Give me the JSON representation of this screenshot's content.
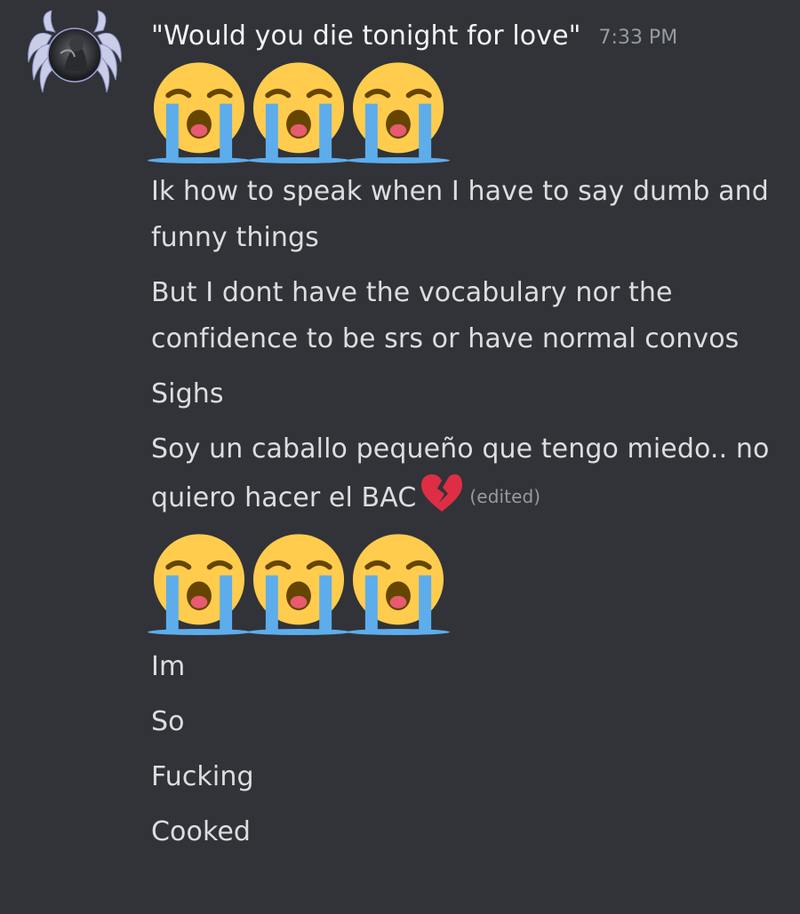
{
  "message": {
    "author": "\"Would you die tonight for love\"",
    "timestamp": "7:33 PM",
    "avatar_icon": "angel-wings-avatar-icon",
    "emoji_icon": "loudly-crying-face-icon",
    "heart_icon": "broken-heart-icon",
    "lines": [
      "Ik how to speak when I have to say dumb and funny things",
      "But I dont have the vocabulary nor the confidence to be srs or have normal convos",
      "Sighs",
      "Soy un caballo pequeño que tengo miedo.. no quiero hacer el BAC",
      "Im",
      "So",
      "Fucking",
      "Cooked"
    ],
    "edited_label": "(edited)"
  },
  "colors": {
    "background": "#313338",
    "text": "#dbdee1",
    "muted": "#949ba4",
    "username": "#f2f3f5"
  }
}
